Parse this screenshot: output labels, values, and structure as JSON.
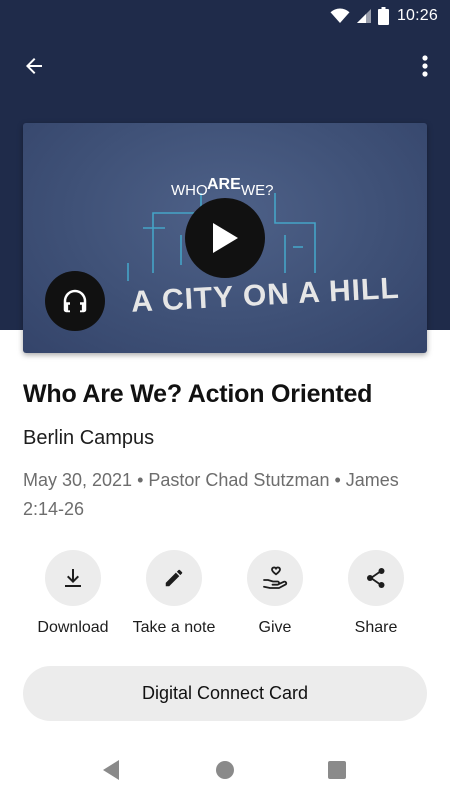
{
  "status_bar": {
    "time": "10:26",
    "icons": [
      "wifi-icon",
      "cellular-signal-icon",
      "battery-icon"
    ]
  },
  "toolbar": {
    "back_icon": "arrow-left-icon",
    "more_icon": "more-vertical-icon"
  },
  "media": {
    "artwork": {
      "line1_left": "WHO",
      "line1_mid": "ARE",
      "line1_right": "WE?",
      "headline": "A CITY ON A HILL"
    },
    "play_icon": "play-icon",
    "audio_icon": "headphones-icon"
  },
  "sermon": {
    "title": "Who Are We? Action Oriented",
    "campus": "Berlin Campus",
    "meta": "May 30, 2021 • Pastor Chad Stutzman • James 2:14-26"
  },
  "actions": [
    {
      "label": "Download",
      "icon": "download-icon"
    },
    {
      "label": "Take a note",
      "icon": "pencil-icon"
    },
    {
      "label": "Give",
      "icon": "give-heart-hand-icon"
    },
    {
      "label": "Share",
      "icon": "share-icon"
    }
  ],
  "connect_card": {
    "label": "Digital Connect Card"
  },
  "colors": {
    "header_bg": "#1f2b4a",
    "artwork_bg": "#3f5177",
    "artwork_lines": "#45a4c7",
    "action_bg": "#ececec",
    "meta_text": "#6d6d6d"
  }
}
